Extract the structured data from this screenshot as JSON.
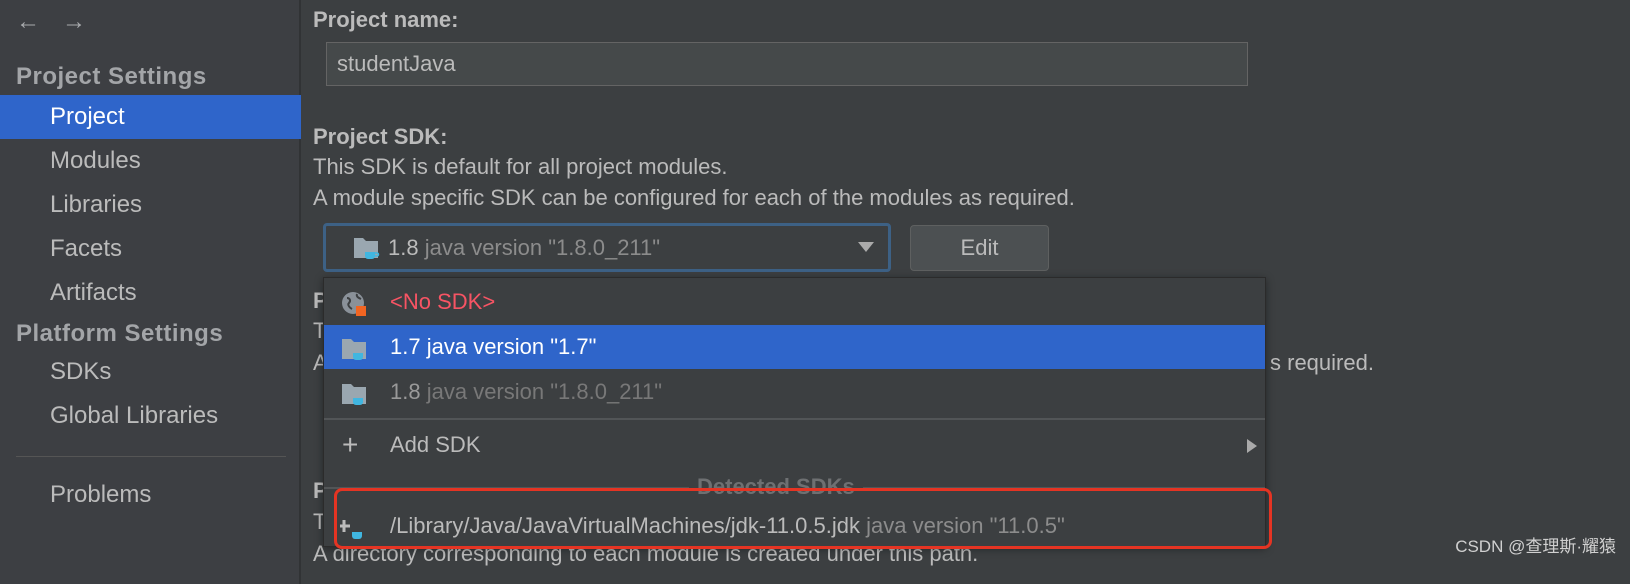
{
  "sidebar": {
    "back_icon": "arrow-left",
    "forward_icon": "arrow-right",
    "project_settings": "Project Settings",
    "items": [
      {
        "label": "Project",
        "selected": true
      },
      {
        "label": "Modules"
      },
      {
        "label": "Libraries"
      },
      {
        "label": "Facets"
      },
      {
        "label": "Artifacts"
      }
    ],
    "platform_settings": "Platform Settings",
    "platform_items": [
      {
        "label": "SDKs"
      },
      {
        "label": "Global Libraries"
      }
    ],
    "problems": "Problems"
  },
  "main": {
    "project_name_label": "Project name:",
    "project_name_value": "studentJava",
    "sdk_label": "Project SDK:",
    "sdk_desc1": "This SDK is default for all project modules.",
    "sdk_desc2": "A module specific SDK can be configured for each of the modules as required.",
    "sdk_selected_name": "1.8",
    "sdk_selected_version": "java version \"1.8.0_211\"",
    "edit_label": "Edit",
    "hidden_fragments": {
      "p1": "P",
      "t1": "T",
      "a1": "A",
      "req": "s required.",
      "p2": "P",
      "t2": "T",
      "bottom": "A directory corresponding to each module is created under this path."
    }
  },
  "popup": {
    "no_sdk": "<No SDK>",
    "no_sdk_color": "#f75464",
    "items": [
      {
        "name": "1.7",
        "version": "java version \"1.7\"",
        "highlighted": true
      },
      {
        "name": "1.8",
        "version": "java version \"1.8.0_211\""
      }
    ],
    "add_sdk": "Add SDK",
    "detected_header": "Detected SDKs",
    "detected": [
      {
        "path": "/Library/Java/JavaVirtualMachines/jdk-11.0.5.jdk",
        "version": "java version \"11.0.5\""
      }
    ]
  },
  "annotation_color": "#e53423",
  "watermark": "CSDN @查理斯·耀猿"
}
